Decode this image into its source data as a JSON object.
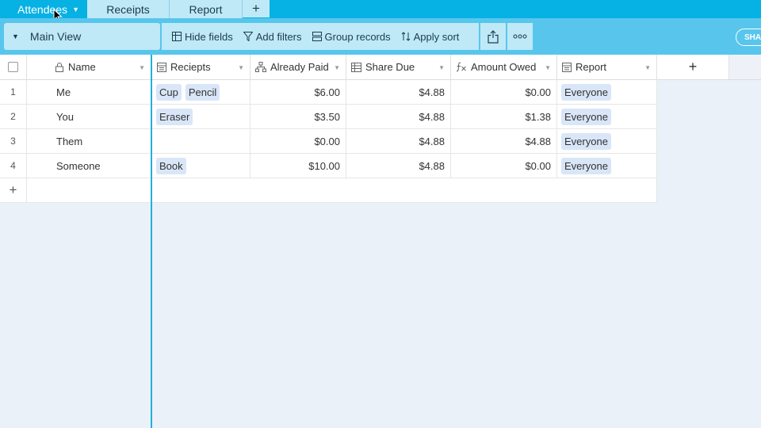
{
  "tabs": [
    {
      "label": "Attendees",
      "active": true
    },
    {
      "label": "Receipts",
      "active": false
    },
    {
      "label": "Report",
      "active": false
    }
  ],
  "add_tab_label": "+",
  "toolbar": {
    "view_name": "Main View",
    "hide_fields": "Hide fields",
    "add_filters": "Add filters",
    "group_records": "Group records",
    "apply_sort": "Apply sort",
    "share_label": "SHA"
  },
  "columns": {
    "name": "Name",
    "receipts": "Reciepts",
    "already_paid": "Already Paid",
    "share_due": "Share Due",
    "amount_owed": "Amount Owed",
    "report": "Report",
    "add": "+"
  },
  "rows": [
    {
      "num": "1",
      "name": "Me",
      "receipts": [
        "Cup",
        "Pencil"
      ],
      "already_paid": "$6.00",
      "share_due": "$4.88",
      "amount_owed": "$0.00",
      "report": "Everyone"
    },
    {
      "num": "2",
      "name": "You",
      "receipts": [
        "Eraser"
      ],
      "already_paid": "$3.50",
      "share_due": "$4.88",
      "amount_owed": "$1.38",
      "report": "Everyone"
    },
    {
      "num": "3",
      "name": "Them",
      "receipts": [],
      "already_paid": "$0.00",
      "share_due": "$4.88",
      "amount_owed": "$4.88",
      "report": "Everyone"
    },
    {
      "num": "4",
      "name": "Someone",
      "receipts": [
        "Book"
      ],
      "already_paid": "$10.00",
      "share_due": "$4.88",
      "amount_owed": "$0.00",
      "report": "Everyone"
    }
  ],
  "add_row_label": "+",
  "colors": {
    "tabbar": "#06b1e3",
    "toolbar": "#58c6ec",
    "frozen_divider": "#22b0d9",
    "chip": "#d9e6f8"
  }
}
